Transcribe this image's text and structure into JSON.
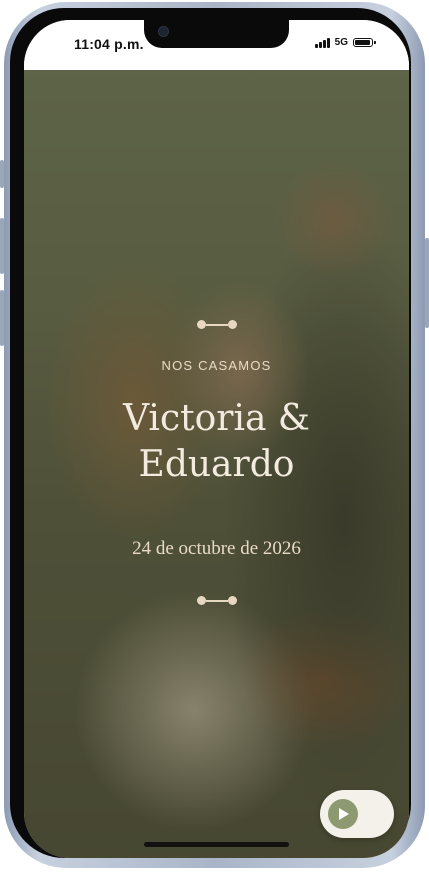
{
  "status_bar": {
    "time": "11:04 p.m.",
    "network": "5G"
  },
  "hero": {
    "eyebrow": "NOS CASAMOS",
    "names_line1": "Victoria &",
    "names_line2": "Eduardo",
    "date": "24 de octubre de 2026"
  },
  "music_button": {
    "icon": "play-icon"
  },
  "colors": {
    "accent": "#8d9a71",
    "text_light": "#f3ebdf",
    "overlay": "#464830"
  }
}
